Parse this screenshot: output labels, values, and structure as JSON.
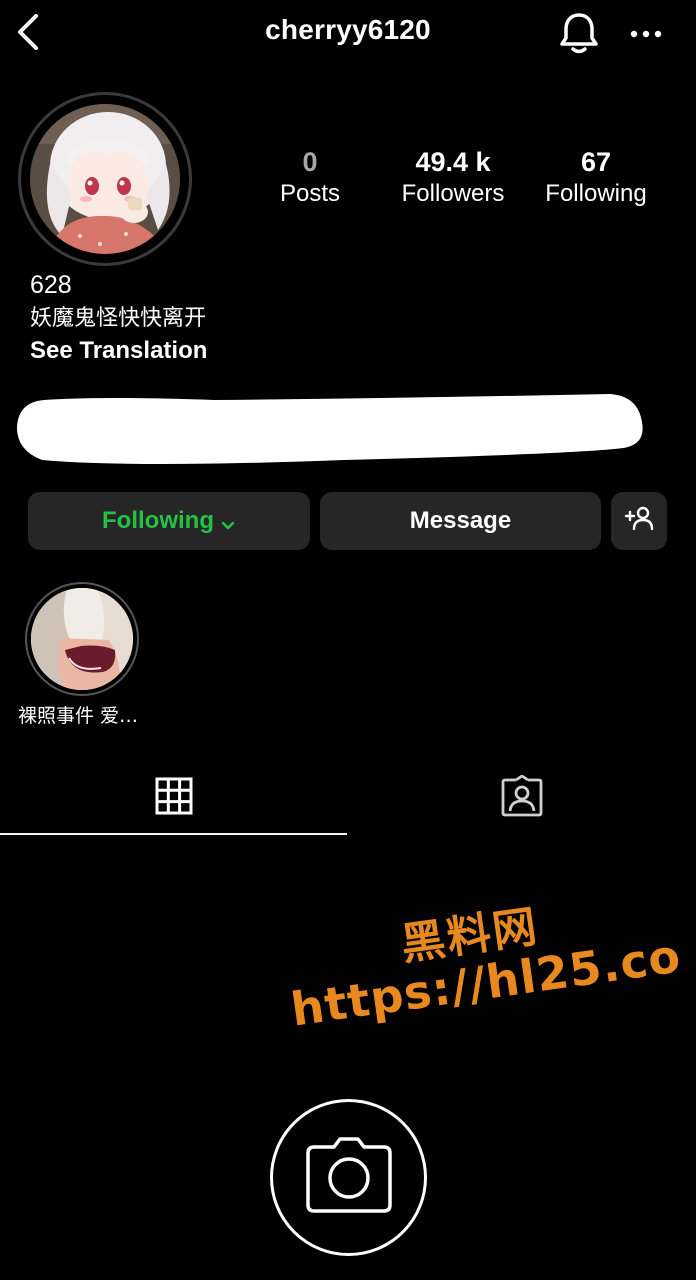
{
  "header": {
    "username": "cherryy6120",
    "icons": [
      "chevron-left-icon",
      "bell-icon",
      "more-horizontal-icon"
    ]
  },
  "profile": {
    "stats": [
      {
        "value": "0",
        "label": "Posts"
      },
      {
        "value": "49.4 k",
        "label": "Followers"
      },
      {
        "value": "67",
        "label": "Following"
      }
    ],
    "name": "628",
    "bio": "妖魔鬼怪快快离开",
    "see_translation": "See Translation"
  },
  "actions": {
    "following_label": "Following",
    "message_label": "Message",
    "following_color": "#22c244"
  },
  "highlights": [
    {
      "label": "裸照事件 爱…"
    }
  ],
  "tabs": [
    "grid-icon",
    "tagged-icon"
  ],
  "watermark": {
    "line1": "黑料网",
    "line2": "https://hl25.co",
    "color": "#e8891f"
  }
}
